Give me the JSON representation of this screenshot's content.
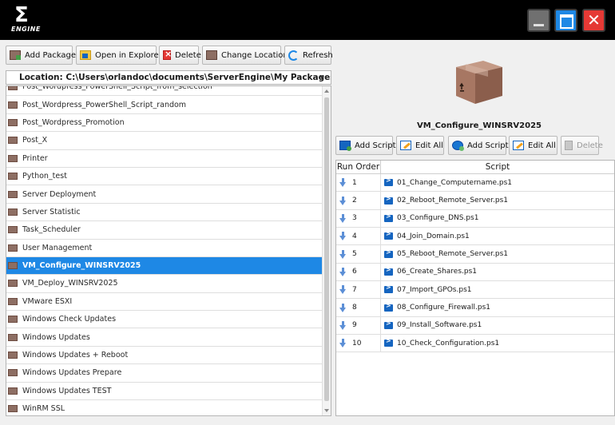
{
  "app": {
    "logo_glyph": "Σ",
    "logo_text": "ENGINE",
    "window_buttons": {
      "minimize": "minimize",
      "maximize": "maximize",
      "close": "✕"
    }
  },
  "toolbar": {
    "add_package": "Add Package",
    "open_in_explorer": "Open in Explorer",
    "delete": "Delete",
    "change_location": "Change Location",
    "refresh": "Refresh"
  },
  "location": {
    "label": "Location: C:\\Users\\orlandoc\\documents\\ServerEngine\\My Packages"
  },
  "packages": [
    {
      "label": "Post_Wordpress_PowerShell_Script_from_selection"
    },
    {
      "label": "Post_Wordpress_PowerShell_Script_random"
    },
    {
      "label": "Post_Wordpress_Promotion"
    },
    {
      "label": "Post_X"
    },
    {
      "label": "Printer"
    },
    {
      "label": "Python_test"
    },
    {
      "label": "Server Deployment"
    },
    {
      "label": "Server Statistic"
    },
    {
      "label": "Task_Scheduler"
    },
    {
      "label": "User Management"
    },
    {
      "label": "VM_Configure_WINSRV2025",
      "selected": true
    },
    {
      "label": "VM_Deploy_WINSRV2025"
    },
    {
      "label": "VMware ESXI"
    },
    {
      "label": "Windows Check Updates"
    },
    {
      "label": "Windows Updates"
    },
    {
      "label": "Windows Updates + Reboot"
    },
    {
      "label": "Windows Updates Prepare"
    },
    {
      "label": "Windows Updates TEST"
    },
    {
      "label": "WinRM SSL"
    }
  ],
  "selected_package": {
    "name": "VM_Configure_WINSRV2025"
  },
  "script_toolbar": {
    "add_script": "Add Script",
    "edit_all": "Edit All",
    "add_script_2": "Add Script",
    "edit_all_2": "Edit All",
    "delete": "Delete"
  },
  "script_table": {
    "headers": {
      "run_order": "Run Order",
      "script": "Script"
    },
    "rows": [
      {
        "order": "1",
        "script": "01_Change_Computername.ps1"
      },
      {
        "order": "2",
        "script": "02_Reboot_Remote_Server.ps1"
      },
      {
        "order": "3",
        "script": "03_Configure_DNS.ps1"
      },
      {
        "order": "4",
        "script": "04_Join_Domain.ps1"
      },
      {
        "order": "5",
        "script": "05_Reboot_Remote_Server.ps1"
      },
      {
        "order": "6",
        "script": "06_Create_Shares.ps1"
      },
      {
        "order": "7",
        "script": "07_Import_GPOs.ps1"
      },
      {
        "order": "8",
        "script": "08_Configure_Firewall.ps1"
      },
      {
        "order": "9",
        "script": "09_Install_Software.ps1"
      },
      {
        "order": "10",
        "script": "10_Check_Configuration.ps1"
      }
    ]
  },
  "colors": {
    "titlebar": "#000000",
    "selection": "#1e88e5",
    "close": "#e53935",
    "maximize": "#1e88e5",
    "minimize": "#707070"
  }
}
